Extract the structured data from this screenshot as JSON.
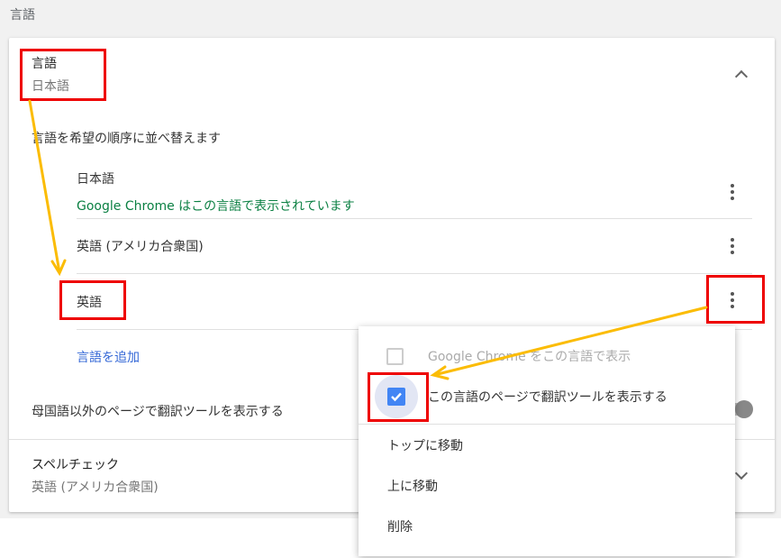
{
  "section_title": "言語",
  "languages": {
    "title": "言語",
    "subtitle": "日本語",
    "order_label": "言語を希望の順序に並べ替えます",
    "items": [
      {
        "name": "日本語",
        "note": "Google Chrome はこの言語で表示されています"
      },
      {
        "name": "英語 (アメリカ合衆国)"
      },
      {
        "name": "英語"
      }
    ],
    "add_language": "言語を追加",
    "translate_offer": "母国語以外のページで翻訳ツールを表示する"
  },
  "spellcheck": {
    "title": "スペルチェック",
    "subtitle": "英語 (アメリカ合衆国)"
  },
  "menu": {
    "display_chrome": {
      "label": "Google Chrome をこの言語で表示",
      "checked": false,
      "disabled": true
    },
    "offer_translate": {
      "label": "この言語のページで翻訳ツールを表示する",
      "checked": true
    },
    "move_top": "トップに移動",
    "move_up": "上に移動",
    "remove": "削除"
  },
  "colors": {
    "accent": "#4285f4",
    "green": "#0b8043",
    "link": "#3367d6",
    "annotation_red": "#ee0000",
    "annotation_arrow": "#fbbc04"
  }
}
